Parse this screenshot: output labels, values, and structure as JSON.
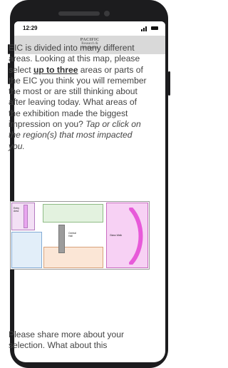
{
  "status_bar": {
    "time": "12:29"
  },
  "header": {
    "logo_line1": "PACIFIC",
    "logo_line2": "Research &",
    "logo_line3": "Evaluation"
  },
  "question": {
    "part1": "EIC is divided into many different areas. Looking at this map, please select ",
    "emphasis": "up to three",
    "part2": " areas or parts of the EIC you think you will remember the most or are still thinking about after leaving today. What areas of the exhibition made the biggest impression on you? ",
    "instruction": "Tap or click on the region(s) that most impacted you."
  },
  "map": {
    "labels": {
      "entry": "Entry Area",
      "central": "Central Hall",
      "glass": "Glass Walk"
    },
    "colors": {
      "entry_fill": "#f3e0f5",
      "entry_stroke": "#b57cc0",
      "entry_bar": "#e9a6ef",
      "top_fill": "#e3f2df",
      "top_stroke": "#8fbc85",
      "left_fill": "#e2eef9",
      "left_stroke": "#84acd6",
      "bottom_fill": "#fbe6d6",
      "bottom_stroke": "#d8a27c",
      "pillar_fill": "#9c9c9c",
      "right_fill": "#f7d1f4",
      "right_stroke": "#c96cc0",
      "arc": "#e75ad9"
    }
  },
  "followup": {
    "text": "Please share more about your selection. What about this"
  }
}
